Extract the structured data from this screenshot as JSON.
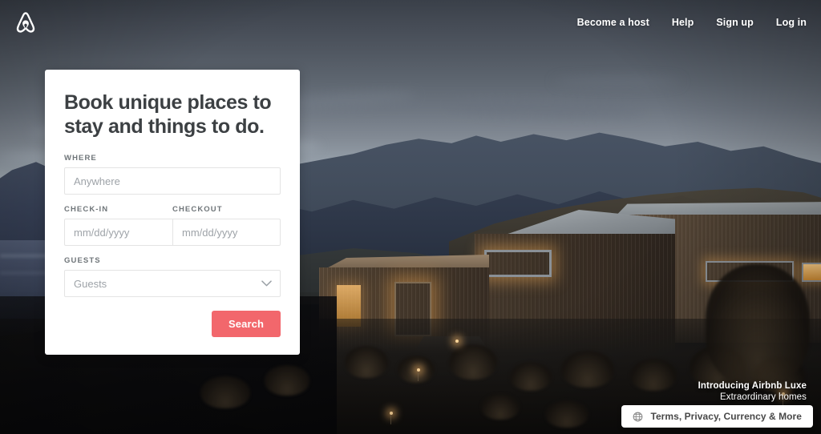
{
  "header": {
    "logo_icon": "airbnb-belo-logo",
    "nav": [
      {
        "label": "Become a host"
      },
      {
        "label": "Help"
      },
      {
        "label": "Sign up"
      },
      {
        "label": "Log in"
      }
    ]
  },
  "search_card": {
    "heading": "Book unique places to stay and things to do.",
    "where": {
      "label": "WHERE",
      "placeholder": "Anywhere",
      "value": ""
    },
    "checkin": {
      "label": "CHECK-IN",
      "placeholder": "mm/dd/yyyy",
      "value": ""
    },
    "checkout": {
      "label": "CHECKOUT",
      "placeholder": "mm/dd/yyyy",
      "value": ""
    },
    "guests": {
      "label": "GUESTS",
      "placeholder": "Guests",
      "value": "",
      "chevron_icon": "chevron-down-icon"
    },
    "search_button": {
      "label": "Search",
      "color": "#F2676C"
    }
  },
  "promo": {
    "line1": "Introducing Airbnb Luxe",
    "line2": "Extraordinary homes"
  },
  "terms_bar": {
    "globe_icon": "globe-icon",
    "label": "Terms, Privacy, Currency & More"
  },
  "hero": {
    "description": "Dusk photo of a modern dark-timber house with lit windows beside a lake and mountains"
  }
}
